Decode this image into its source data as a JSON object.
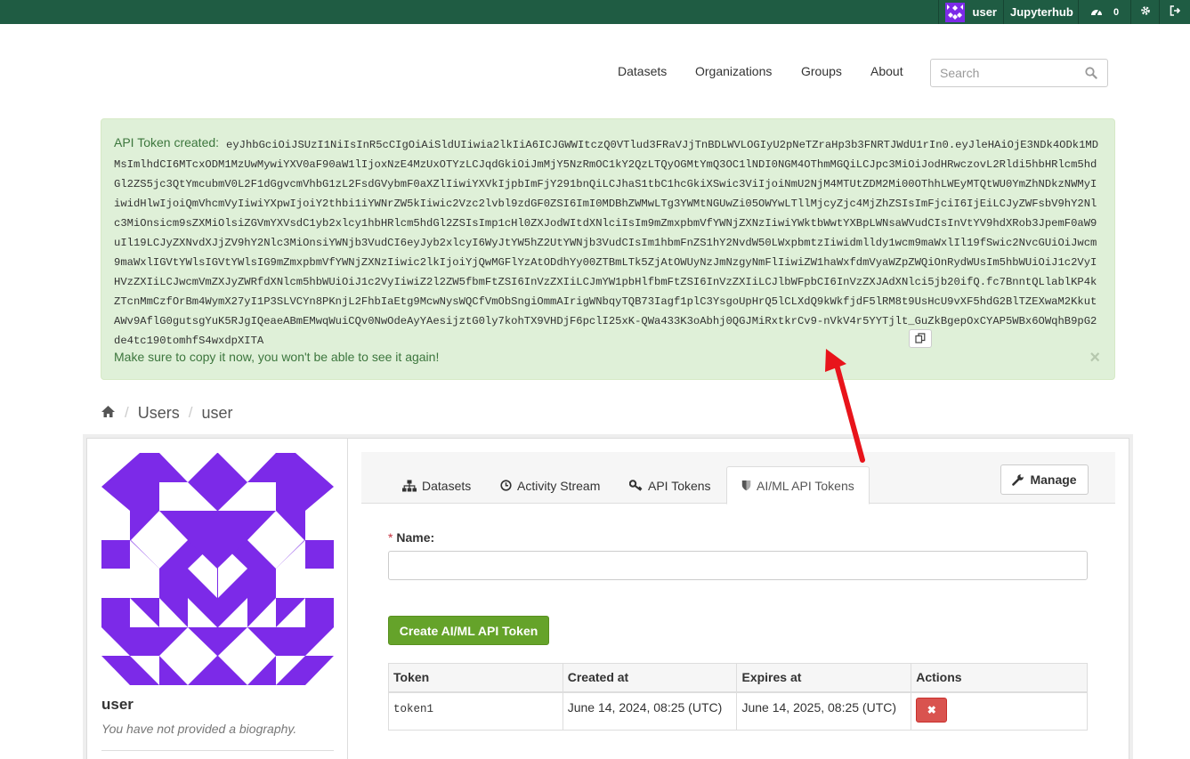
{
  "topbar": {
    "username": "user",
    "hub_link": "Jupyterhub",
    "activity_count": "0",
    "icons": [
      "avatar",
      "dashboard-icon",
      "gear-icon",
      "sign-out-icon"
    ]
  },
  "nav": {
    "items": [
      "Datasets",
      "Organizations",
      "Groups",
      "About"
    ],
    "search_placeholder": "Search"
  },
  "flash": {
    "label": "API Token created:",
    "token": "eyJhbGciOiJSUzI1NiIsInR5cCIgOiAiSldUIiwia2lkIiA6ICJGWWItczQ0VTlud3FRaVJjTnBDLWVLOGIyU2pNeTZraHp3b3FNRTJWdU1rIn0.eyJleHAiOjE3NDk4ODk1MDMsImlhdCI6MTcxODM1MzUwMywiYXV0aF90aW1lIjoxNzE4MzUxOTYzLCJqdGkiOiJmMjY5NzRmOC1kY2QzLTQyOGMtYmQ3OC1lNDI0NGM4OThmMGQiLCJpc3MiOiJodHRwczovL2Rldi5hbHRlcm5hdGl2ZS5jc3QtYmcubmV0L2F1dGgvcmVhbG1zL2FsdGVybmF0aXZlIiwiYXVkIjpbImFjY291bnQiLCJhaS1tbC1hcGkiXSwic3ViIjoiNmU2NjM4MTUtZDM2Mi00OThhLWEyMTQtWU0YmZhNDkzNWMyIiwidHlwIjoiQmVhcmVyIiwiYXpwIjoiY2thbi1iYWNrZW5kIiwic2Vzc2lvbl9zdGF0ZSI6ImI0MDBhZWMwLTg3YWMtNGUwZi05OWYwLTllMjcyZjc4MjZhZSIsImFjciI6IjEiLCJyZWFsbV9hY2Nlc3MiOnsicm9sZXMiOlsiZGVmYXVsdC1yb2xlcy1hbHRlcm5hdGl2ZSIsImp1cHl0ZXJodWItdXNlciIsIm9mZmxpbmVfYWNjZXNzIiwiYWktbWwtYXBpLWNsaWVudCIsInVtYV9hdXRob3JpemF0aW9uIl19LCJyZXNvdXJjZV9hY2Nlc3MiOnsiYWNjb3VudCI6eyJyb2xlcyI6WyJtYW5hZ2UtYWNjb3VudCIsIm1hbmFnZS1hY2NvdW50LWxpbmtzIiwidmlldy1wcm9maWxlIl19fSwic2NvcGUiOiJwcm9maWxlIGVtYWlsIGVtYWlsIG9mZmxpbmVfYWNjZXNzIiwic2lkIjoiYjQwMGFlYzAtODdhYy00ZTBmLTk5ZjAtOWUyNzJmNzgyNmFlIiwiZW1haWxfdmVyaWZpZWQiOnRydWUsIm5hbWUiOiJ1c2VyIHVzZXIiLCJwcmVmZXJyZWRfdXNlcm5hbWUiOiJ1c2VyIiwiZ2l2ZW5fbmFtZSI6InVzZXIiLCJmYW1pbHlfbmFtZSI6InVzZXIiLCJlbWFpbCI6InVzZXJAdXNlci5jb20ifQ.fc7BnntQLlablKP4kZTcnMmCzfOrBm4WymX27yI1P3SLVCYn8PKnjL2FhbIaEtg9McwNysWQCfVmObSngiOmmAIrigWNbqyTQB73Iagf1plC3YsgoUpHrQ5lCLXdQ9kWkfjdF5lRM8t9UsHcU9vXF5hdG2BlTZEXwaM2KkutAWv9AflG0gutsgYuK5RJgIQeaeABmEMwqWuiCQv0NwOdeAyYAesijztG0ly7kohTX9VHDjF6pclI25xK-QWa433K3oAbhj0QGJMiRxtkrCv9-nVkV4r5YYTjlt_GuZkBgepOxCYAP5WBx6OWqhB9pG2de4tc190tomhfS4wxdpXITA",
    "warning": "Make sure to copy it now, you won't be able to see it again!",
    "close": "×"
  },
  "breadcrumb": {
    "items": [
      "Users",
      "user"
    ]
  },
  "profile": {
    "name": "user",
    "bio": "You have not provided a biography."
  },
  "tabs": [
    {
      "label": "Datasets",
      "icon": "sitemap-icon"
    },
    {
      "label": "Activity Stream",
      "icon": "clock-icon"
    },
    {
      "label": "API Tokens",
      "icon": "key-icon"
    },
    {
      "label": "AI/ML API Tokens",
      "icon": "shield-icon",
      "active": true
    }
  ],
  "manage_label": "Manage",
  "form": {
    "required_mark": "*",
    "name_label": "Name:",
    "name_value": "",
    "submit_label": "Create AI/ML API Token"
  },
  "table": {
    "headers": [
      "Token",
      "Created at",
      "Expires at",
      "Actions"
    ],
    "rows": [
      {
        "token": "token1",
        "created": "June 14, 2024, 08:25 (UTC)",
        "expires": "June 14, 2025, 08:25 (UTC)",
        "action": "✖"
      }
    ]
  },
  "colors": {
    "topbar": "#1f5c43",
    "avatar": "#7c2ae8",
    "alert_bg": "#dff0d8",
    "alert_text": "#3c763d",
    "create_button": "#65a32a",
    "delete_button": "#d9534f",
    "annotation_arrow": "#e8141b"
  }
}
